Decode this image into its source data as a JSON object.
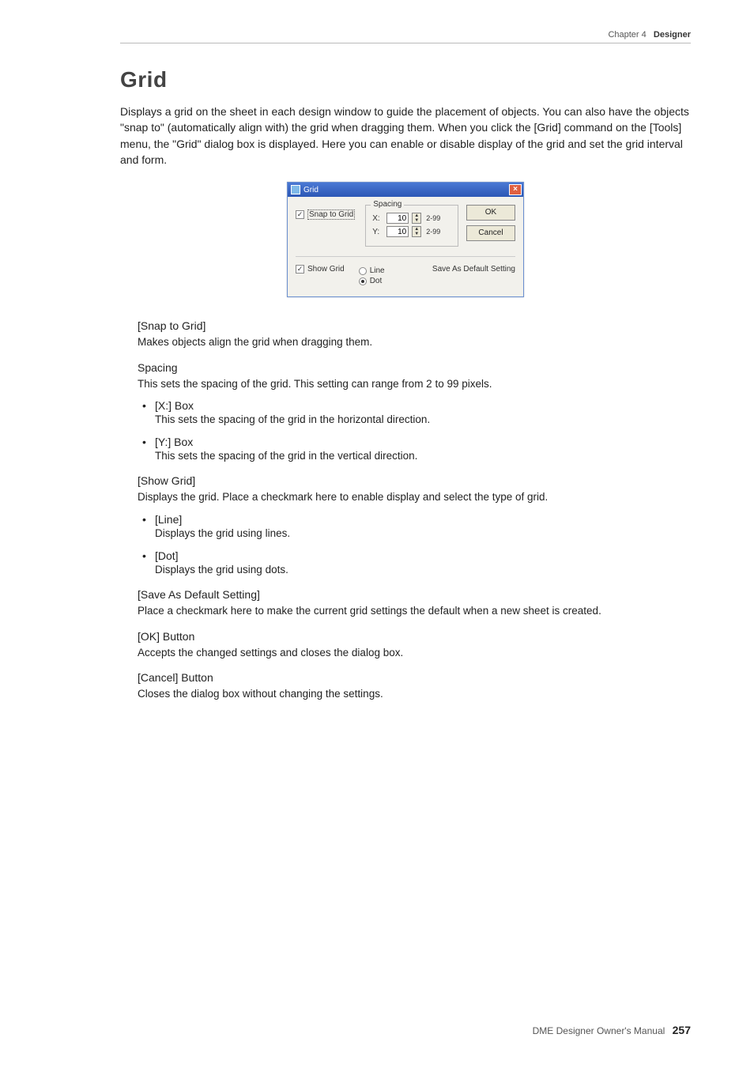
{
  "header": {
    "chapter": "Chapter 4",
    "section": "Designer"
  },
  "title": "Grid",
  "intro": "Displays a grid on the sheet in each design window to guide the placement of objects. You can also have the objects \"snap to\" (automatically align with) the grid when dragging them. When you click the [Grid] command on the [Tools] menu, the \"Grid\" dialog box is displayed. Here you can enable or disable display of the grid and set the grid interval and form.",
  "dialog": {
    "title": "Grid",
    "snap_to_grid": "Snap to Grid",
    "spacing_legend": "Spacing",
    "x_label": "X:",
    "y_label": "Y:",
    "x_value": "10",
    "y_value": "10",
    "range": "2-99",
    "ok": "OK",
    "cancel": "Cancel",
    "show_grid": "Show Grid",
    "line": "Line",
    "dot": "Dot",
    "save_default": "Save As Default Setting"
  },
  "sections": {
    "snap": {
      "h": "[Snap to Grid]",
      "p": "Makes objects align the grid when dragging them."
    },
    "spacing": {
      "h": "Spacing",
      "p": "This sets the spacing of the grid. This setting can range from 2 to 99 pixels.",
      "items": [
        {
          "t": "[X:] Box",
          "d": "This sets the spacing of the grid in the horizontal direction."
        },
        {
          "t": "[Y:] Box",
          "d": "This sets the spacing of the grid in the vertical direction."
        }
      ]
    },
    "showgrid": {
      "h": "[Show Grid]",
      "p": "Displays the grid. Place a checkmark here to enable display and select the type of grid.",
      "items": [
        {
          "t": "[Line]",
          "d": "Displays the grid using lines."
        },
        {
          "t": "[Dot]",
          "d": "Displays the grid using dots."
        }
      ]
    },
    "savedef": {
      "h": "[Save As Default Setting]",
      "p": "Place a checkmark here to make the current grid settings the default when a new sheet is created."
    },
    "ok": {
      "h": "[OK] Button",
      "p": "Accepts the changed settings and closes the dialog box."
    },
    "cancel": {
      "h": "[Cancel] Button",
      "p": "Closes the dialog box without changing the settings."
    }
  },
  "footer": {
    "manual": "DME Designer Owner's Manual",
    "page": "257"
  }
}
